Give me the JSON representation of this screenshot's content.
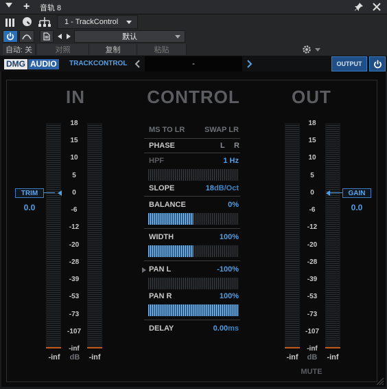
{
  "window": {
    "title": "音轨 8",
    "dropdown_icon": "triangle-down-icon",
    "pin_icon": "pin-icon",
    "close_icon": "close-icon"
  },
  "host_toolbar": {
    "plugin_slot": "1 - TrackControl",
    "preset": "默认",
    "auto_label": "自动: 关",
    "compare_label": "对照",
    "copy_label": "复制",
    "paste_label": "粘贴"
  },
  "plugin_header": {
    "brand": "DMG",
    "brand_sub": "AUDIO",
    "product": "TRACKCONTROL",
    "preset_display": "-",
    "output_label": "OUTPUT"
  },
  "sections": {
    "in": "IN",
    "control": "CONTROL",
    "out": "OUT"
  },
  "scale": [
    "18",
    "15",
    "10",
    "5",
    "0",
    "-6",
    "-12",
    "-20",
    "-28",
    "-39",
    "-53",
    "-73",
    "-107",
    "-inf"
  ],
  "in": {
    "trim_label": "TRIM",
    "trim_value": "0.0",
    "meter_left_label": "-inf",
    "meter_db_label": "dB",
    "meter_right_label": "-inf"
  },
  "out": {
    "gain_label": "GAIN",
    "gain_value": "0.0",
    "meter_left_label": "-inf",
    "meter_db_label": "dB",
    "meter_right_label": "-inf",
    "mute_label": "MUTE"
  },
  "control": {
    "ms_to_lr": "MS TO LR",
    "swap_lr": "SWAP LR",
    "phase_label": "PHASE",
    "phase_l": "L",
    "phase_r": "R",
    "hpf_label": "HPF",
    "hpf_value": "1 Hz",
    "hpf_fill": 0.0,
    "slope_label": "SLOPE",
    "slope_value": "18",
    "slope_unit": "dB/Oct",
    "balance_label": "BALANCE",
    "balance_value": "0%",
    "balance_fill": 0.5,
    "width_label": "WIDTH",
    "width_value": "100%",
    "width_fill": 0.5,
    "panl_label": "PAN L",
    "panl_value": "-100%",
    "panl_fill": 0.0,
    "panr_label": "PAN R",
    "panr_value": "100%",
    "panr_fill": 1.0,
    "delay_label": "DELAY",
    "delay_value": "0.00",
    "delay_unit": "ms"
  }
}
